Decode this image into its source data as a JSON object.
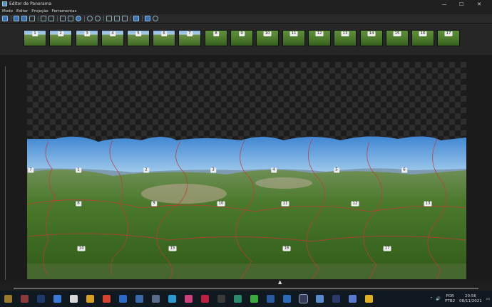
{
  "window": {
    "title": "Editor de Panorama",
    "minimize": "—",
    "maximize": "☐",
    "close": "✕"
  },
  "menu": {
    "items": [
      "Modo",
      "Editar",
      "Projeção",
      "Ferramentas"
    ]
  },
  "thumbnails": [
    "1",
    "2",
    "3",
    "4",
    "5",
    "6",
    "7",
    "8",
    "9",
    "10",
    "11",
    "12",
    "13",
    "14",
    "15",
    "16",
    "17"
  ],
  "segments": [
    "1",
    "2",
    "3",
    "4",
    "5",
    "6",
    "7",
    "8",
    "9",
    "10",
    "11",
    "12",
    "13",
    "14",
    "15",
    "16",
    "17"
  ],
  "tray": {
    "language": "POR",
    "layout": "PTB2",
    "time": "20:56",
    "date": "08/11/2021"
  },
  "taskbar_colors": [
    "#9a7a2a",
    "#8a3a3a",
    "#1f3a6a",
    "#3a7ad8",
    "#d8d8d8",
    "#d8a020",
    "#d84030",
    "#2a6ac8",
    "#3a6aa8",
    "#5a6a8a",
    "#2a9ad0",
    "#d0407a",
    "#c02040",
    "#3a3a3a",
    "#2a8a6a",
    "#3aaa3a",
    "#2a5aa0",
    "#2a6ab8",
    "#3a3a5a",
    "#5a8ad0",
    "#2a3a6a",
    "#5a7ad0",
    "#e0b020"
  ]
}
